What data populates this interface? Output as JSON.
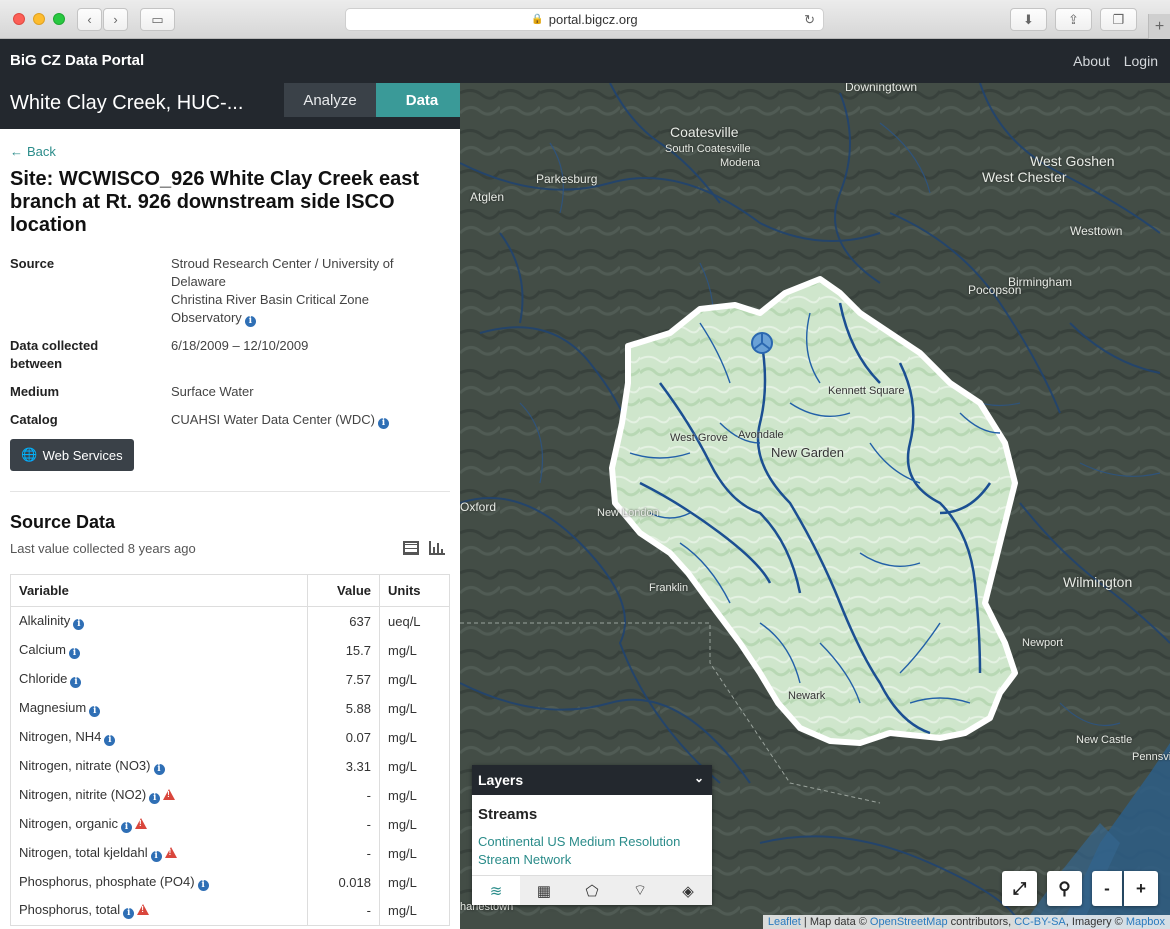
{
  "browser": {
    "url": "portal.bigcz.org"
  },
  "app": {
    "brand": "BiG CZ Data Portal",
    "nav": [
      "About",
      "Login"
    ]
  },
  "sidebar": {
    "title": "White Clay Creek, HUC-...",
    "tabs": [
      {
        "label": "Analyze",
        "active": false
      },
      {
        "label": "Data",
        "active": true
      }
    ],
    "back_label": "Back",
    "site_title": "Site: WCWISCO_926 White Clay Creek east branch at Rt. 926 downstream side ISCO location",
    "meta": {
      "source_key": "Source",
      "source_val1": "Stroud Research Center / University of Delaware",
      "source_val2": "Christina River Basin Critical Zone Observatory",
      "collected_key": "Data collected between",
      "collected_val": "6/18/2009  –  12/10/2009",
      "medium_key": "Medium",
      "medium_val": "Surface Water",
      "catalog_key": "Catalog",
      "catalog_val": "CUAHSI Water Data Center (WDC)"
    },
    "web_services_label": "Web Services",
    "source_data_title": "Source Data",
    "source_data_sub": "Last value collected 8 years ago",
    "table": {
      "headers": [
        "Variable",
        "Value",
        "Units"
      ],
      "rows": [
        {
          "variable": "Alkalinity",
          "value": "637",
          "units": "ueq/L"
        },
        {
          "variable": "Calcium",
          "value": "15.7",
          "units": "mg/L"
        },
        {
          "variable": "Chloride",
          "value": "7.57",
          "units": "mg/L"
        },
        {
          "variable": "Magnesium",
          "value": "5.88",
          "units": "mg/L"
        },
        {
          "variable": "Nitrogen, NH4",
          "value": "0.07",
          "units": "mg/L"
        },
        {
          "variable": "Nitrogen, nitrate (NO3)",
          "value": "3.31",
          "units": "mg/L"
        },
        {
          "variable": "Nitrogen, nitrite (NO2)",
          "value": "-",
          "units": "mg/L"
        },
        {
          "variable": "Nitrogen, organic",
          "value": "-",
          "units": "mg/L"
        },
        {
          "variable": "Nitrogen, total kjeldahl",
          "value": "-",
          "units": "mg/L"
        },
        {
          "variable": "Phosphorus, phosphate (PO4)",
          "value": "0.018",
          "units": "mg/L"
        },
        {
          "variable": "Phosphorus, total",
          "value": "-",
          "units": "mg/L"
        }
      ]
    }
  },
  "map": {
    "places": {
      "downingtown": "Downingtown",
      "coatesville": "Coatesville",
      "south_coatesville": "South Coatesville",
      "modena": "Modena",
      "parkesburg": "Parkesburg",
      "atglen": "Atglen",
      "west_goshen": "West Goshen",
      "west_chester": "West Chester",
      "westtown": "Westtown",
      "birmingham": "Birmingham",
      "pocopson": "Pocopson",
      "kennett_square": "Kennett Square",
      "west_grove": "West Grove",
      "avondale": "Avondale",
      "new_garden": "New Garden",
      "oxford": "Oxford",
      "new_london": "New London",
      "franklin": "Franklin",
      "wilmington": "Wilmington",
      "newport": "Newport",
      "newark": "Newark",
      "new_castle": "New Castle",
      "pennsville": "Pennsvi",
      "charlestown": "harlestown"
    },
    "layers_panel": {
      "header": "Layers",
      "section_title": "Streams",
      "link": "Continental US Medium Resolution Stream Network"
    },
    "controls": [
      "⤢",
      "⚲",
      "-",
      "+"
    ],
    "attribution": {
      "leaflet": "Leaflet",
      "sep1": " | Map data © ",
      "osm": "OpenStreetMap",
      "sep2": " contributors, ",
      "ccbysa": "CC-BY-SA",
      "sep3": ", Imagery © ",
      "mapbox": "Mapbox"
    }
  }
}
